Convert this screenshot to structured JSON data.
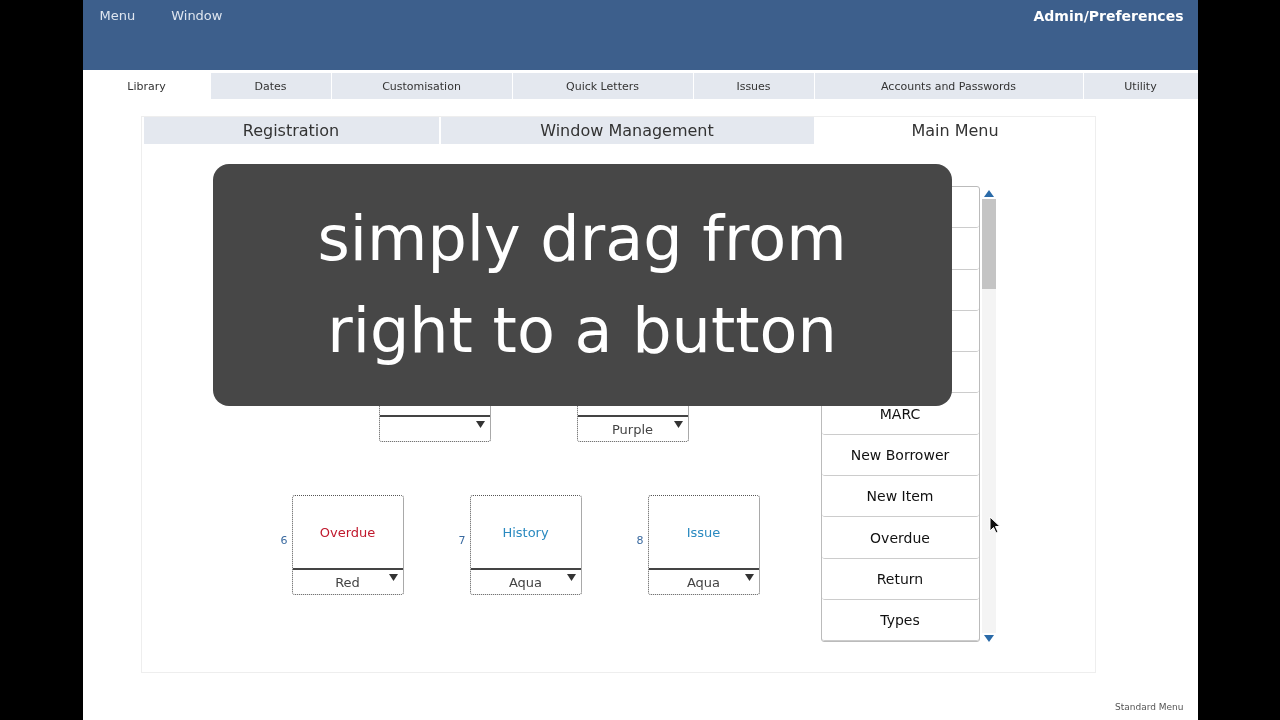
{
  "menu_bar": {
    "items": [
      "Menu",
      "Window"
    ],
    "title": "Admin/Preferences"
  },
  "tabs": [
    {
      "label": "Library",
      "selected": true
    },
    {
      "label": "Dates",
      "selected": false
    },
    {
      "label": "Customisation",
      "selected": false
    },
    {
      "label": "Quick Letters",
      "selected": false
    },
    {
      "label": "Issues",
      "selected": false
    },
    {
      "label": "Accounts and Passwords",
      "selected": false
    },
    {
      "label": "Utility",
      "selected": false
    }
  ],
  "sub_tabs": [
    {
      "label": "Registration",
      "selected": false
    },
    {
      "label": "Window Management",
      "selected": false
    },
    {
      "label": "Main Menu",
      "selected": true
    }
  ],
  "slot_rows": [
    [
      {
        "kind": "covered"
      },
      {
        "kind": "covered",
        "colour_choice": "Purple"
      }
    ],
    [
      {
        "kind": "full",
        "number": "6",
        "label": "Overdue",
        "color": "#c0182c",
        "colour_choice": "Red"
      },
      {
        "kind": "full",
        "number": "7",
        "label": "History",
        "color": "#2a8ac0",
        "colour_choice": "Aqua"
      },
      {
        "kind": "full",
        "number": "8",
        "label": "Issue",
        "color": "#2a8ac0",
        "colour_choice": "Aqua"
      }
    ]
  ],
  "function_list": [
    "MARC",
    "New Borrower",
    "New Item",
    "Overdue",
    "Return",
    "Types"
  ],
  "caption": [
    "simply drag from",
    "right to a button"
  ],
  "footer": "Standard Menu"
}
